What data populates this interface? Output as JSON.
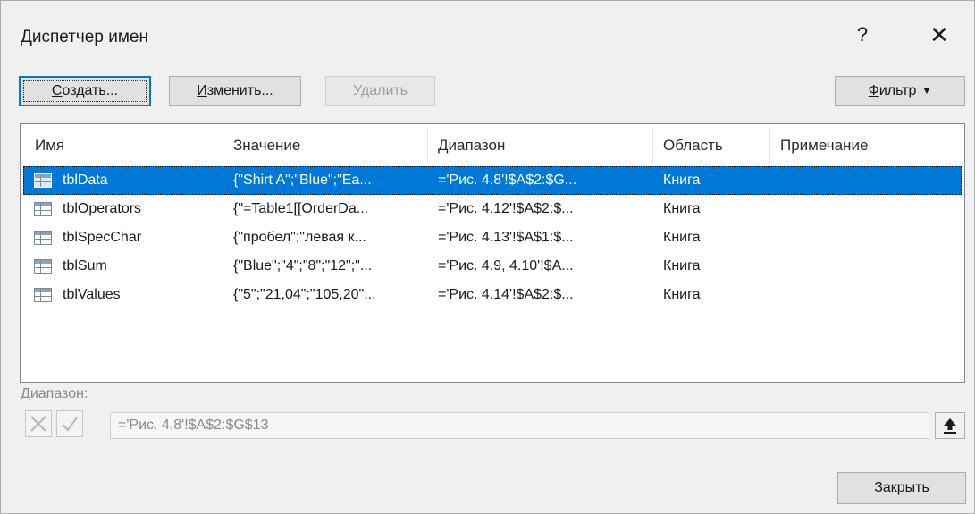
{
  "dialog": {
    "title": "Диспетчер имен",
    "help": "?",
    "close_glyph": "✕"
  },
  "toolbar": {
    "create": {
      "accel": "С",
      "rest": "оздать..."
    },
    "edit": {
      "accel": "И",
      "rest": "зменить..."
    },
    "delete": {
      "label": "Удалить"
    },
    "filter": {
      "accel": "Ф",
      "rest": "ильтр",
      "caret": "▼"
    }
  },
  "list": {
    "columns": [
      "Имя",
      "Значение",
      "Диапазон",
      "Область",
      "Примечание"
    ],
    "rows": [
      {
        "name": "tblData",
        "value": "{\"Shirt A\";\"Blue\";\"Ea...",
        "range": "='Рис. 4.8'!$A$2:$G...",
        "scope": "Книга",
        "note": "",
        "selected": true
      },
      {
        "name": "tblOperators",
        "value": "{\"=Table1[[OrderDa...",
        "range": "='Рис. 4.12'!$A$2:$...",
        "scope": "Книга",
        "note": ""
      },
      {
        "name": "tblSpecChar",
        "value": "{\"пробел\";\"левая к...",
        "range": "='Рис. 4.13'!$A$1:$...",
        "scope": "Книга",
        "note": ""
      },
      {
        "name": "tblSum",
        "value": "{\"Blue\";\"4\";\"8\";\"12\";\"...",
        "range": "='Рис. 4.9, 4.10'!$A...",
        "scope": "Книга",
        "note": ""
      },
      {
        "name": "tblValues",
        "value": "{\"5\";\"21,04\";\"105,20\"...",
        "range": "='Рис. 4.14'!$A$2:$...",
        "scope": "Книга",
        "note": ""
      }
    ]
  },
  "range_section": {
    "label": "Диапазон:",
    "value": "='Рис. 4.8'!$A$2:$G$13"
  },
  "footer": {
    "close": "Закрыть"
  },
  "colors": {
    "selection": "#0078d7",
    "dialog_bg": "#f0f0f0"
  }
}
